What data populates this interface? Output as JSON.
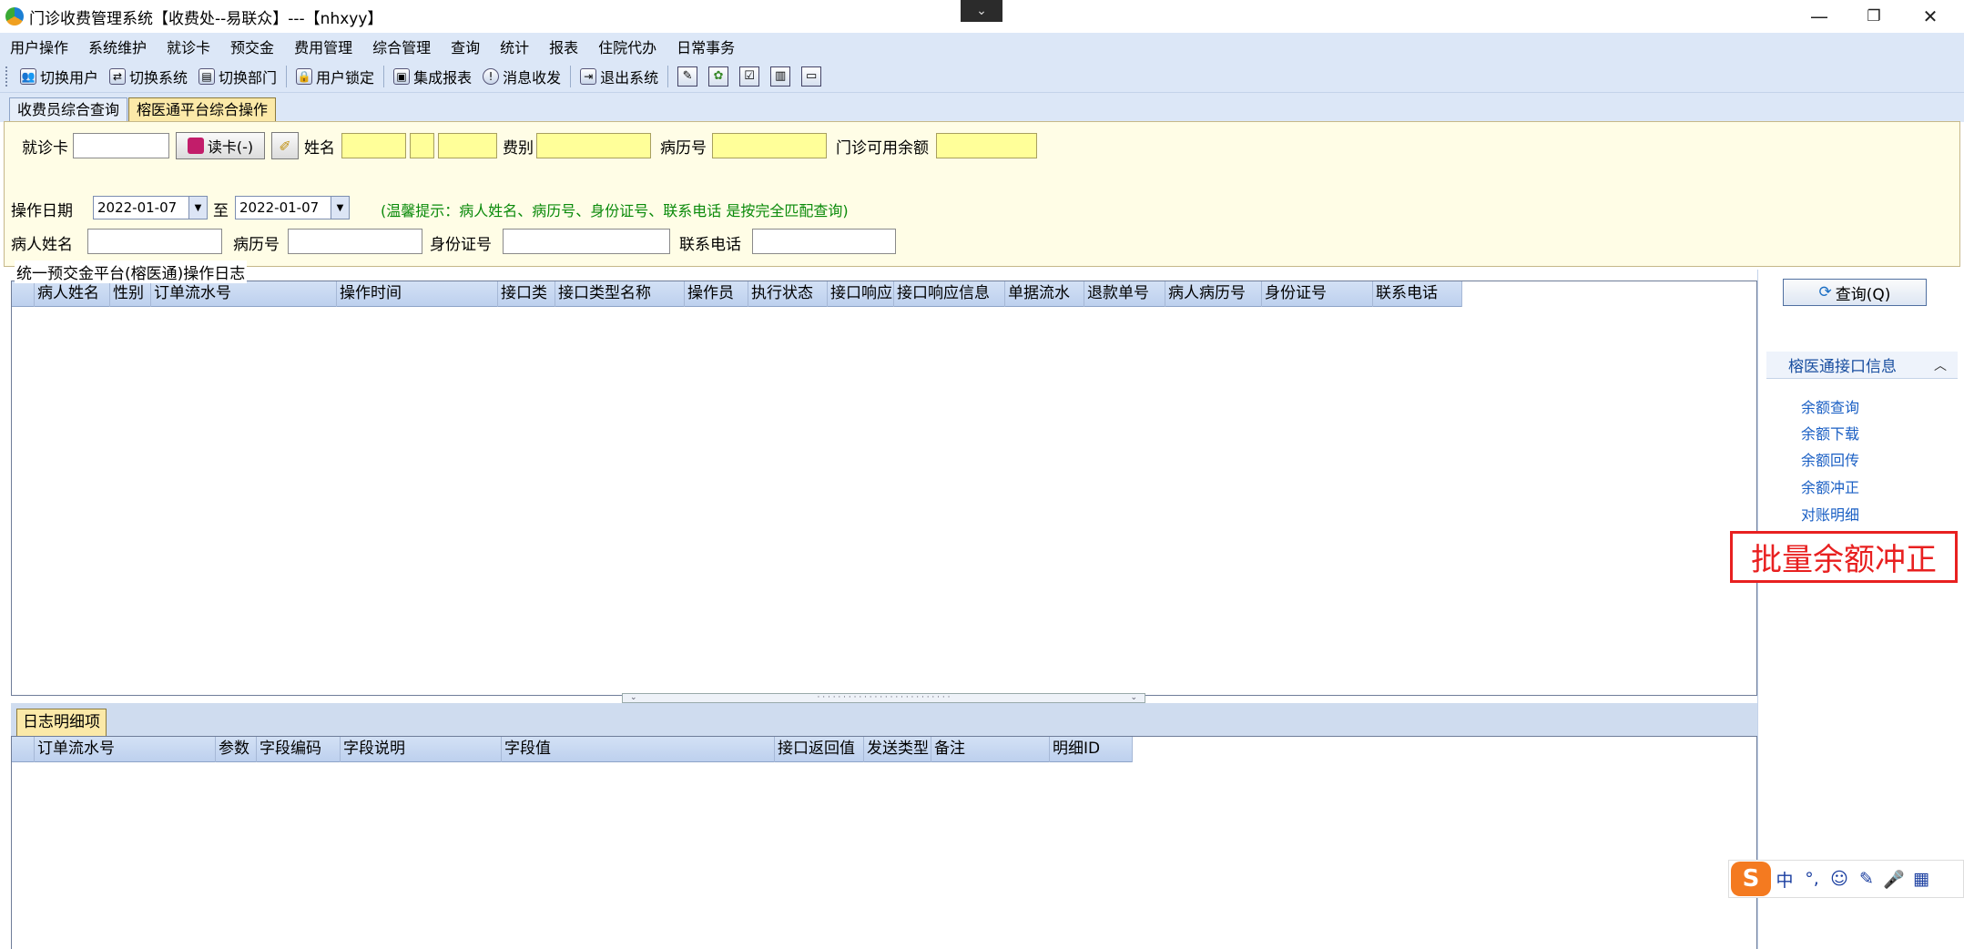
{
  "window": {
    "title": "门诊收费管理系统【收费处--易联众】---【nhxyy】",
    "collapse_glyph": "⌄",
    "minimize_glyph": "—",
    "restore_glyph": "❐",
    "close_glyph": "✕"
  },
  "menu": [
    "用户操作",
    "系统维护",
    "就诊卡",
    "预交金",
    "费用管理",
    "综合管理",
    "查询",
    "统计",
    "报表",
    "住院代办",
    "日常事务"
  ],
  "toolbar": {
    "switch_user": "切换用户",
    "switch_system": "切换系统",
    "switch_dept": "切换部门",
    "lock_user": "用户锁定",
    "integrated_report": "集成报表",
    "message": "消息收发",
    "exit_system": "退出系统"
  },
  "tabs": [
    "收费员综合查询",
    "榕医通平台综合操作"
  ],
  "form": {
    "card_label": "就诊卡",
    "read_card_label": "读卡(-)",
    "name_label": "姓名",
    "fee_type_label": "费别",
    "record_no_label": "病历号",
    "balance_label": "门诊可用余额",
    "op_date_label": "操作日期",
    "date_from": "2022-01-07",
    "to_label": "至",
    "date_to": "2022-01-07",
    "hint": "(温馨提示：病人姓名、病历号、身份证号、联系电话 是按完全匹配查询)",
    "patient_name_label": "病人姓名",
    "record_no_label2": "病历号",
    "id_no_label": "身份证号",
    "phone_label": "联系电话"
  },
  "log_group": {
    "title": "统一预交金平台(榕医通)操作日志",
    "columns": [
      "病人姓名",
      "性别",
      "订单流水号",
      "操作时间",
      "接口类",
      "接口类型名称",
      "操作员",
      "执行状态",
      "接口响应",
      "接口响应信息",
      "单据流水",
      "退款单号",
      "病人病历号",
      "身份证号",
      "联系电话"
    ]
  },
  "detail": {
    "tab_label": "日志明细项",
    "columns": [
      "订单流水号",
      "参数",
      "字段编码",
      "字段说明",
      "字段值",
      "接口返回值",
      "发送类型",
      "备注",
      "明细ID"
    ]
  },
  "side": {
    "query_button": "查询(Q)",
    "section_title": "榕医通接口信息",
    "links": [
      "余额查询",
      "余额下载",
      "余额回传",
      "余额冲正",
      "对账明细"
    ],
    "annotation": "批量余额冲正"
  },
  "ime": {
    "logo": "S",
    "items": [
      "中",
      "°,",
      "☺",
      "✎",
      "🎤",
      "▦"
    ]
  }
}
